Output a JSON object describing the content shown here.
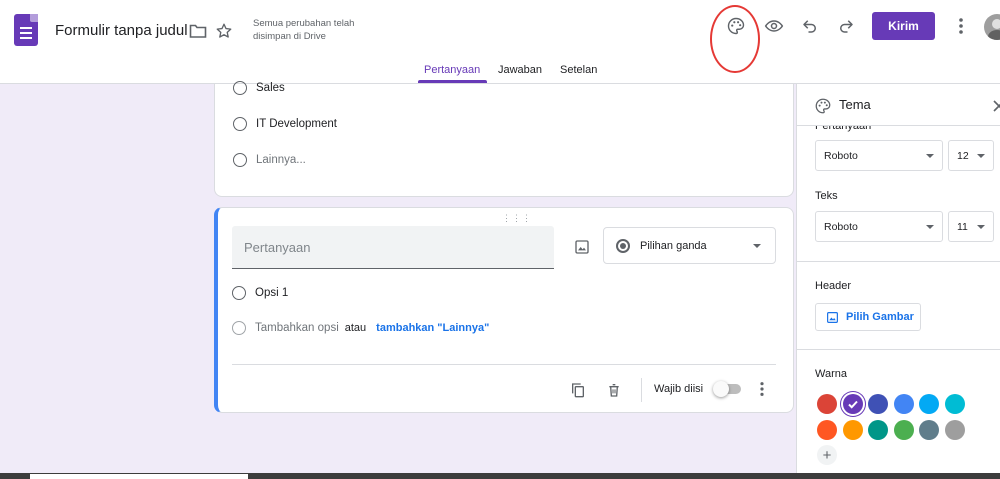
{
  "header": {
    "title": "Formulir tanpa judul",
    "save_status_line1": "Semua perubahan telah",
    "save_status_line2": "disimpan di Drive",
    "send_label": "Kirim"
  },
  "tabs": [
    {
      "label": "Pertanyaan",
      "active": true
    },
    {
      "label": "Jawaban",
      "active": false
    },
    {
      "label": "Setelan",
      "active": false
    }
  ],
  "question1": {
    "options": [
      "Sales",
      "IT Development",
      "Lainnya..."
    ]
  },
  "question2": {
    "placeholder": "Pertanyaan",
    "type_label": "Pilihan ganda",
    "option1": "Opsi 1",
    "add_option": "Tambahkan opsi",
    "or": "atau",
    "add_other": "tambahkan \"Lainnya\"",
    "required_label": "Wajib diisi"
  },
  "theme_panel": {
    "title": "Tema",
    "question_label": "Pertanyaan",
    "question_font": "Roboto",
    "question_size": "12",
    "text_label": "Teks",
    "text_font": "Roboto",
    "text_size": "11",
    "header_label": "Header",
    "choose_image": "Pilih Gambar",
    "color_label": "Warna",
    "colors": [
      "#db4437",
      "#673ab7",
      "#3f51b5",
      "#4285f4",
      "#03a9f4",
      "#00bcd4",
      "#ff5722",
      "#ff9800",
      "#009688",
      "#4caf50",
      "#607d8b",
      "#9e9e9e"
    ],
    "selected_color": "#673ab7"
  },
  "colors": {
    "accent": "#673ab7",
    "link": "#1a73e8",
    "background": "#f0ebf8"
  }
}
